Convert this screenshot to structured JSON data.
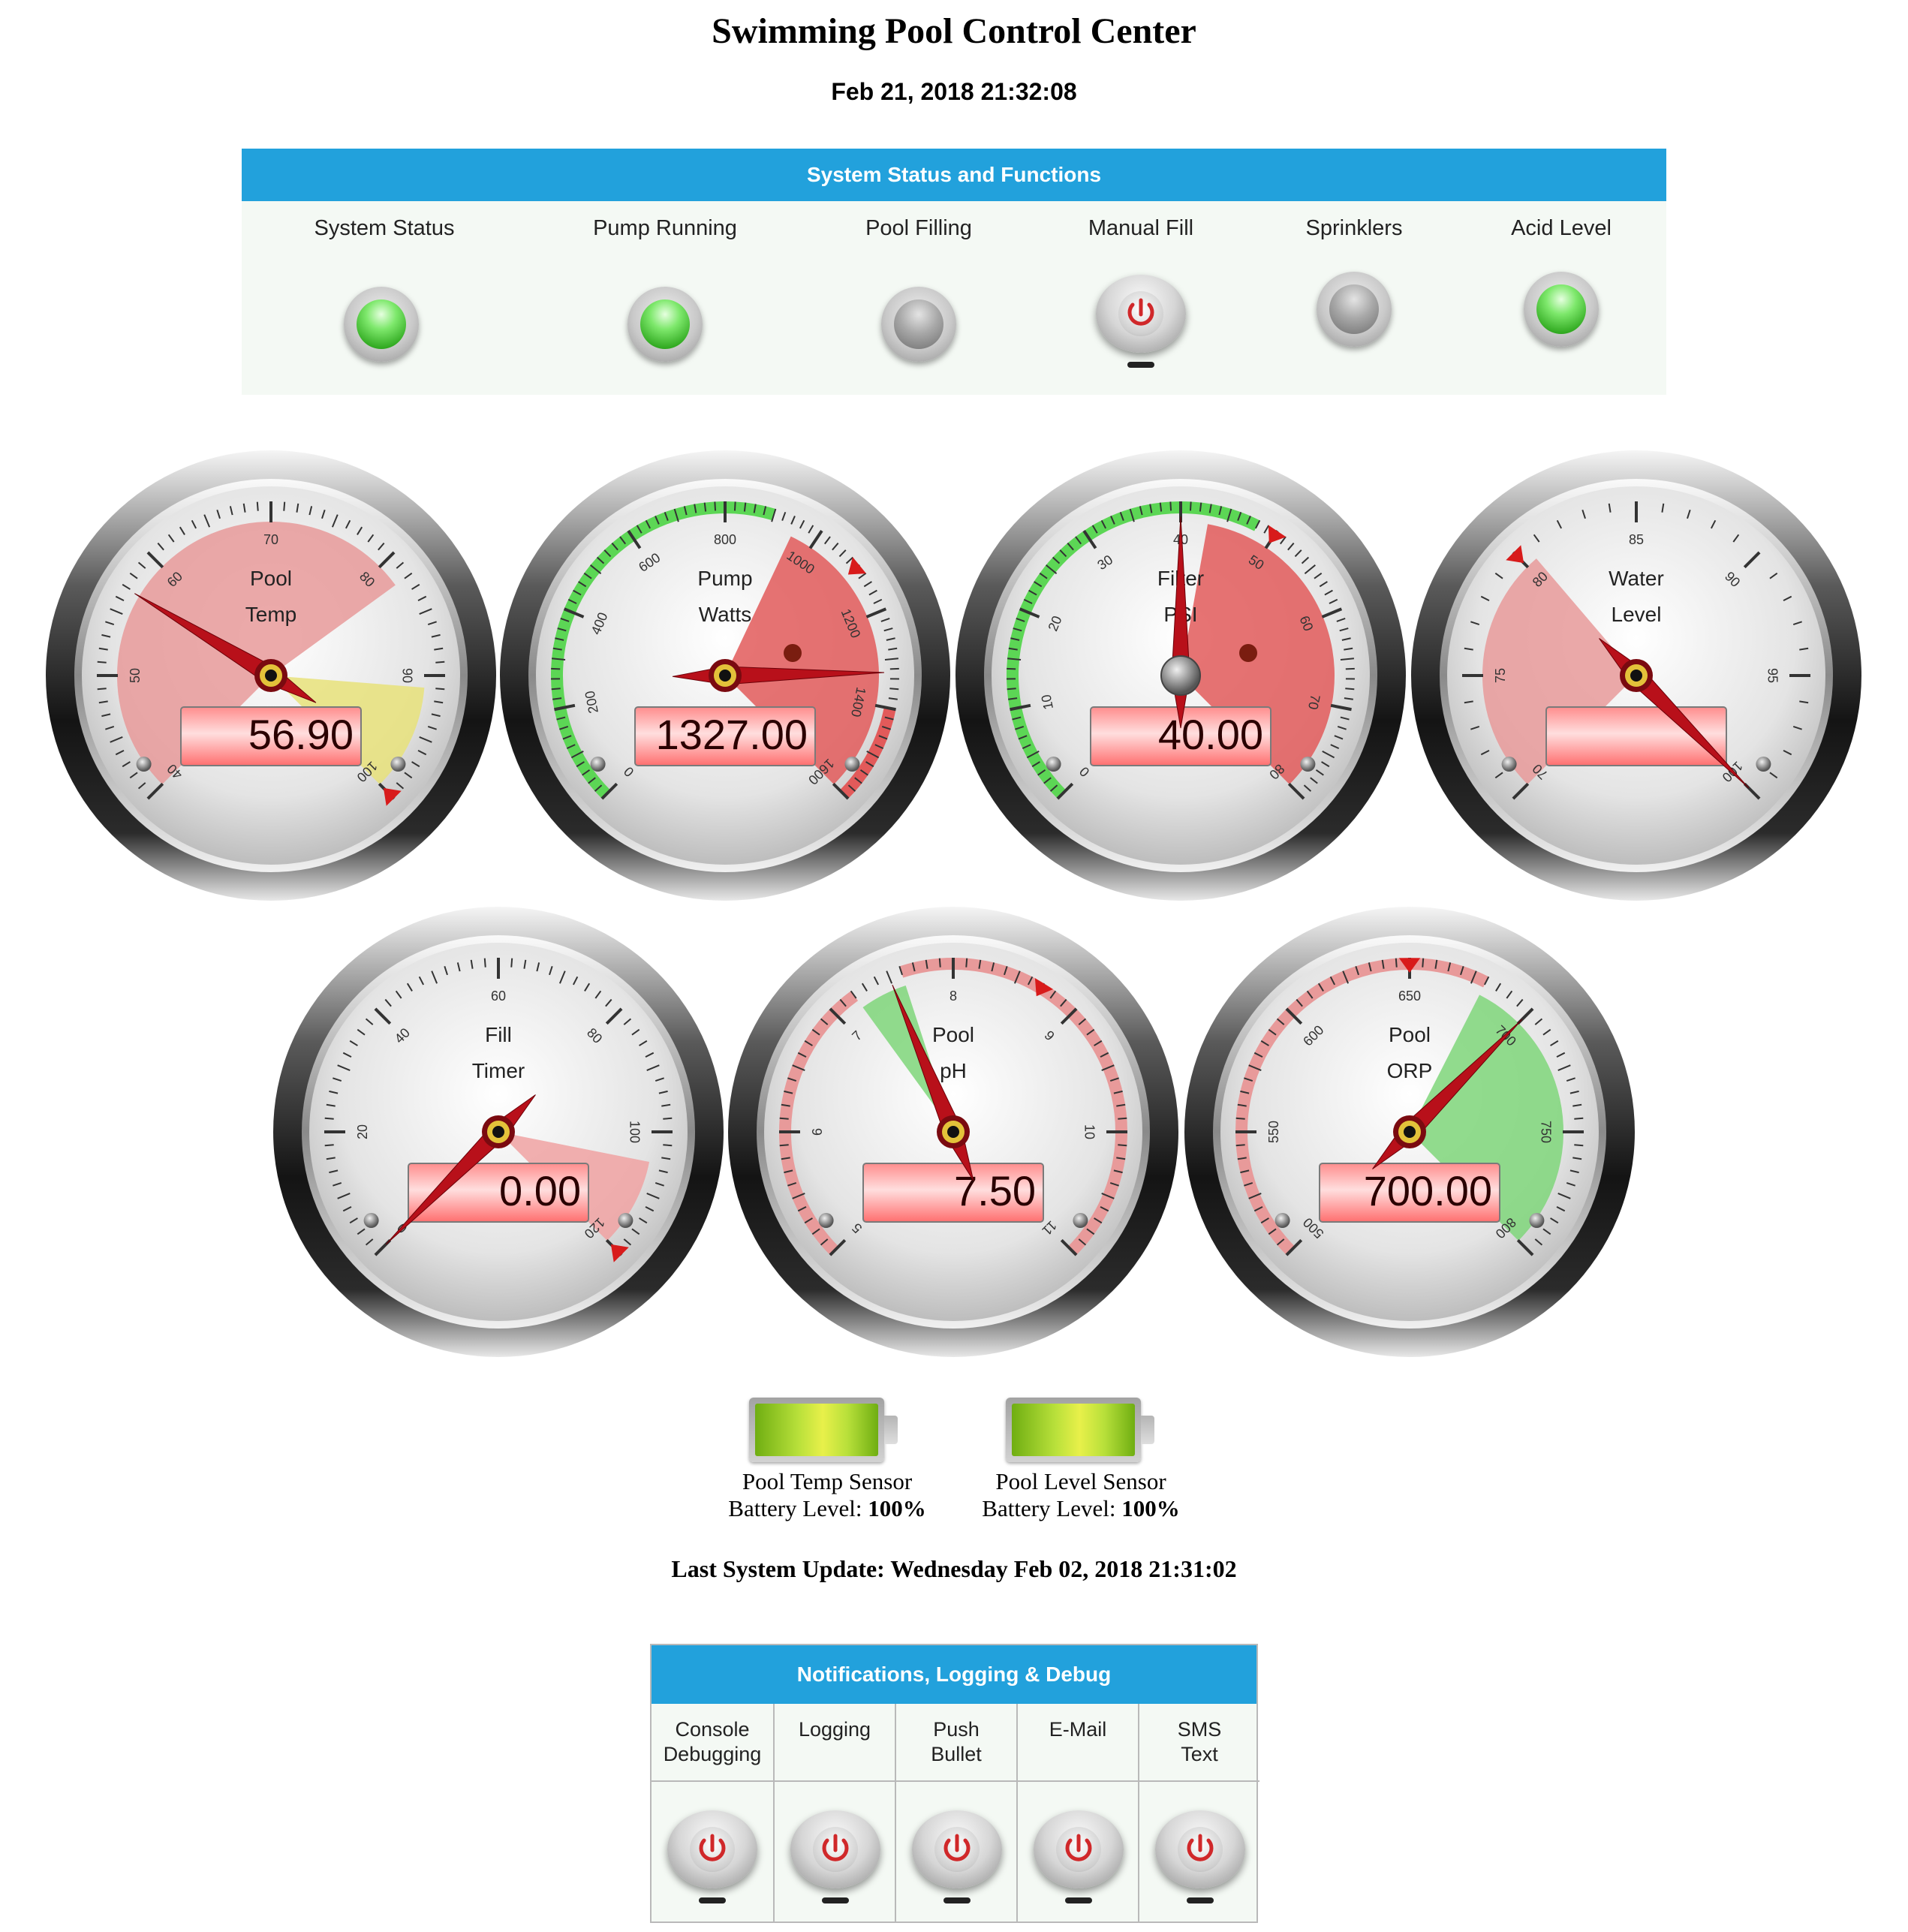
{
  "page": {
    "title": "Swimming Pool Control Center",
    "datetime": "Feb 21, 2018 21:32:08"
  },
  "status_panel": {
    "header": "System Status and Functions",
    "items": [
      {
        "label": "System Status",
        "type": "led",
        "state": "on"
      },
      {
        "label": "Pump Running",
        "type": "led",
        "state": "on"
      },
      {
        "label": "Pool Filling",
        "type": "led",
        "state": "off"
      },
      {
        "label": "Manual Fill",
        "type": "power-button",
        "state": "off"
      },
      {
        "label": "Sprinklers",
        "type": "led",
        "state": "off"
      },
      {
        "label": "Acid Level",
        "type": "led",
        "state": "on"
      }
    ]
  },
  "gauges": [
    {
      "title": [
        "Pool",
        "Temp"
      ],
      "min": 40,
      "max": 100,
      "major": 10,
      "minor": 1,
      "value": 56.9,
      "display": "56.90",
      "labels": [
        "40",
        "50",
        "60",
        "70",
        "80",
        "90",
        "100"
      ],
      "zones": [
        {
          "from": 40,
          "to": 82,
          "color": "#e89a9a"
        },
        {
          "from": 91,
          "to": 100,
          "color": "#e8e27a"
        }
      ],
      "marker": 100
    },
    {
      "title": [
        "Pump",
        "Watts"
      ],
      "min": 0,
      "max": 1600,
      "major": 200,
      "minor": 20,
      "value": 1327,
      "display": "1327.00",
      "labels": [
        "0",
        "200",
        "400",
        "600",
        "800",
        "1000",
        "1200",
        "1400",
        "1600"
      ],
      "zones": [
        {
          "from": 950,
          "to": 1600,
          "color": "#e25a5a"
        }
      ],
      "rims": [
        {
          "from": 0,
          "to": 900,
          "color": "#5cd655"
        },
        {
          "from": 1400,
          "to": 1600,
          "color": "#e25a5a"
        }
      ],
      "marker": 1100,
      "led": "off-red"
    },
    {
      "title": [
        "Filter",
        "PSI"
      ],
      "min": 0,
      "max": 80,
      "major": 10,
      "minor": 1,
      "value": 40,
      "display": "40.00",
      "labels": [
        "0",
        "10",
        "20",
        "30",
        "40",
        "50",
        "60",
        "70",
        "80"
      ],
      "zones": [
        {
          "from": 43,
          "to": 80,
          "color": "#e25a5a"
        }
      ],
      "rims": [
        {
          "from": 0,
          "to": 48,
          "color": "#5cd655"
        }
      ],
      "marker": 50,
      "led": "off-red"
    },
    {
      "title": [
        "Water",
        "Level"
      ],
      "min": 70,
      "max": 100,
      "major": 5,
      "minor": 1,
      "value": 100,
      "display": "",
      "labels": [
        "70",
        "75",
        "80",
        "85",
        "90",
        "95",
        "100"
      ],
      "zones": [
        {
          "from": 70,
          "to": 80.5,
          "color": "#e89a9a"
        }
      ],
      "marker": 80
    },
    {
      "title": [
        "Fill",
        "Timer"
      ],
      "min": 0,
      "max": 120,
      "major": 20,
      "minor": 2,
      "value": 0,
      "display": "0.00",
      "labels": [
        "0",
        "20",
        "40",
        "60",
        "80",
        "100",
        "120"
      ],
      "zones": [
        {
          "from": 105,
          "to": 120,
          "color": "#f0a2a2"
        }
      ],
      "marker": 120
    },
    {
      "title": [
        "Pool",
        "pH"
      ],
      "min": 5,
      "max": 11,
      "major": 1,
      "minor": 0.1,
      "value": 7.5,
      "display": "7.50",
      "labels": [
        "5",
        "6",
        "7",
        "8",
        "9",
        "10",
        "11"
      ],
      "zones": [
        {
          "from": 7.2,
          "to": 7.6,
          "color": "#7fd67a"
        }
      ],
      "rims": [
        {
          "from": 5,
          "to": 7.2,
          "color": "#e89a9a"
        },
        {
          "from": 7.6,
          "to": 11,
          "color": "#e89a9a"
        }
      ],
      "marker": 8.7
    },
    {
      "title": [
        "Pool",
        "ORP"
      ],
      "min": 500,
      "max": 800,
      "major": 50,
      "minor": 5,
      "value": 700,
      "display": "700.00",
      "labels": [
        "500",
        "550",
        "600",
        "650",
        "700",
        "750",
        "800"
      ],
      "zones": [
        {
          "from": 680,
          "to": 800,
          "color": "#7fd67a"
        }
      ],
      "rims": [
        {
          "from": 500,
          "to": 680,
          "color": "#e89a9a"
        }
      ],
      "marker": 650
    }
  ],
  "batteries": [
    {
      "label": "Pool Temp Sensor",
      "level_label": "Battery Level:",
      "level": "100%",
      "fill": 1.0
    },
    {
      "label": "Pool Level Sensor",
      "level_label": "Battery Level:",
      "level": "100%",
      "fill": 1.0
    }
  ],
  "last_update": "Last System Update: Wednesday Feb 02, 2018 21:31:02",
  "notifications": {
    "header": "Notifications, Logging & Debug",
    "items": [
      {
        "label": [
          "Console",
          "Debugging"
        ],
        "state": "off"
      },
      {
        "label": [
          "Logging"
        ],
        "state": "off"
      },
      {
        "label": [
          "Push",
          "Bullet"
        ],
        "state": "off"
      },
      {
        "label": [
          "E-Mail"
        ],
        "state": "off"
      },
      {
        "label": [
          "SMS",
          "Text"
        ],
        "state": "off"
      }
    ]
  },
  "colors": {
    "header_blue": "#22a1dc",
    "power_red": "#d0282a",
    "needle_red": "#b8101a"
  }
}
